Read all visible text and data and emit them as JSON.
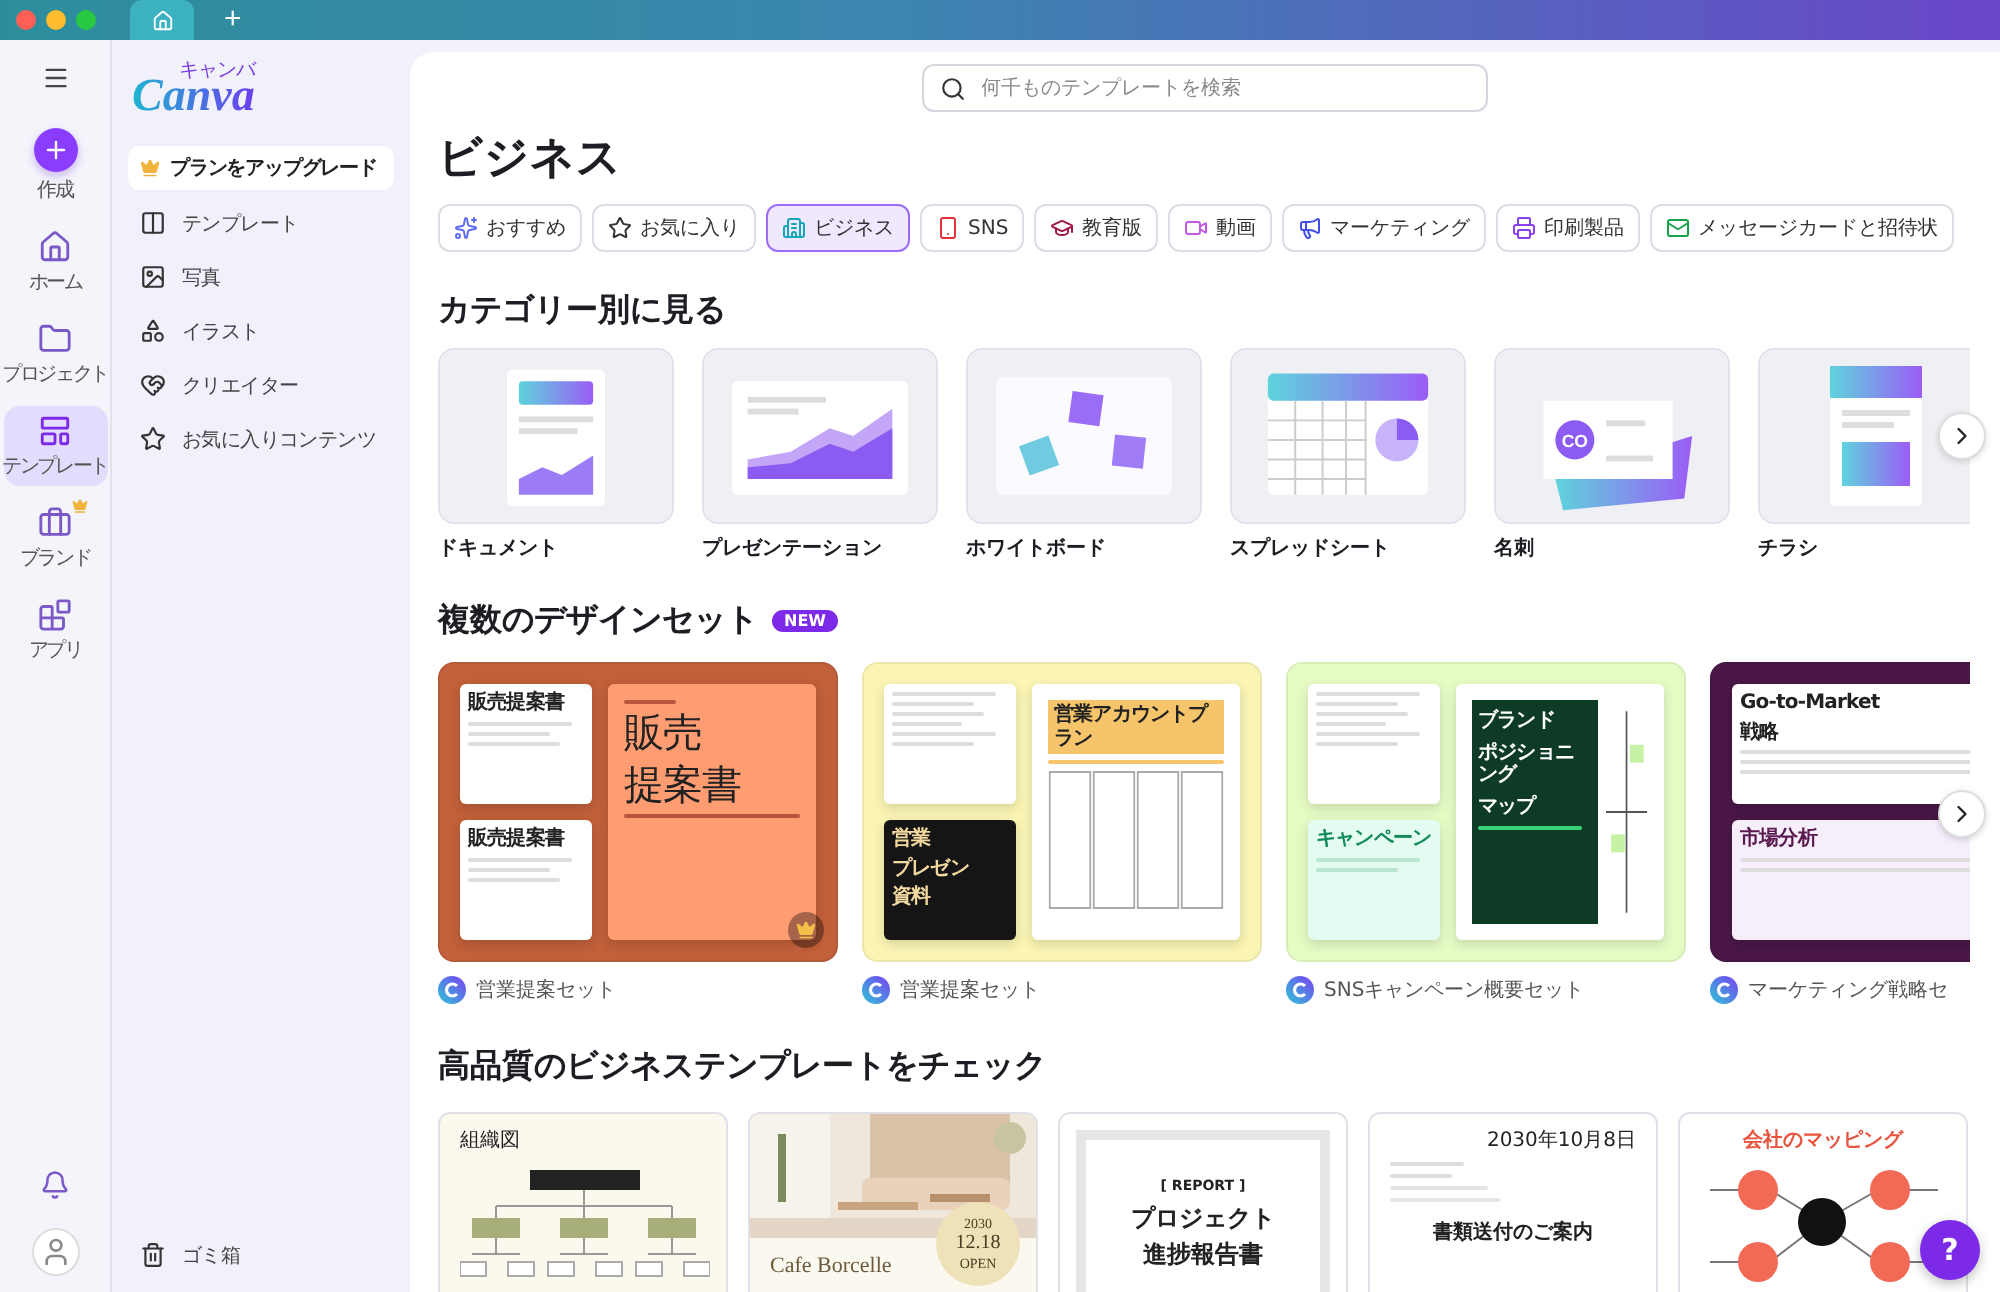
{
  "title_bar": {
    "tabs": [
      {
        "kind": "home",
        "selected": true
      }
    ],
    "new_tab": "+"
  },
  "rail": {
    "items": [
      {
        "label": "作成",
        "kind": "create",
        "selected": false,
        "premium": false
      },
      {
        "label": "ホーム",
        "kind": "home",
        "selected": false,
        "premium": false
      },
      {
        "label": "プロジェクト",
        "kind": "projects",
        "selected": false,
        "premium": false
      },
      {
        "label": "テンプレート",
        "kind": "templates",
        "selected": true,
        "premium": false
      },
      {
        "label": "ブランド",
        "kind": "brand",
        "selected": false,
        "premium": true
      },
      {
        "label": "アプリ",
        "kind": "apps",
        "selected": false,
        "premium": false
      }
    ]
  },
  "side_panel": {
    "logo": "Canva",
    "logo_kana": "キャンバ",
    "upgrade": "プランをアップグレード",
    "items": [
      {
        "label": "テンプレート",
        "kind": "templates"
      },
      {
        "label": "写真",
        "kind": "photos"
      },
      {
        "label": "イラスト",
        "kind": "illustrations"
      },
      {
        "label": "クリエイター",
        "kind": "creators"
      },
      {
        "label": "お気に入りコンテンツ",
        "kind": "favorites"
      }
    ],
    "trash": "ゴミ箱"
  },
  "search": {
    "placeholder": "何千ものテンプレートを検索"
  },
  "heading": "ビジネス",
  "filters": [
    {
      "label": "おすすめ",
      "kind": "recommended",
      "selected": false
    },
    {
      "label": "お気に入り",
      "kind": "favorites",
      "selected": false
    },
    {
      "label": "ビジネス",
      "kind": "business",
      "selected": true
    },
    {
      "label": "SNS",
      "kind": "sns",
      "selected": false
    },
    {
      "label": "教育版",
      "kind": "education",
      "selected": false
    },
    {
      "label": "動画",
      "kind": "video",
      "selected": false
    },
    {
      "label": "マーケティング",
      "kind": "marketing",
      "selected": false
    },
    {
      "label": "印刷製品",
      "kind": "print",
      "selected": false
    },
    {
      "label": "メッセージカードと招待状",
      "kind": "cards",
      "selected": false
    }
  ],
  "categories": {
    "title": "カテゴリー別に見る",
    "items": [
      {
        "label": "ドキュメント",
        "kind": "document"
      },
      {
        "label": "プレゼンテーション",
        "kind": "presentation"
      },
      {
        "label": "ホワイトボード",
        "kind": "whiteboard"
      },
      {
        "label": "スプレッドシート",
        "kind": "spreadsheet"
      },
      {
        "label": "名刺",
        "kind": "business_card",
        "mark": "CO"
      },
      {
        "label": "チラシ",
        "kind": "flyer"
      }
    ]
  },
  "design_sets": {
    "title": "複数のデザインセット",
    "badge": "NEW",
    "items": [
      {
        "name": "営業提案セット",
        "color": "#c1603a",
        "premium": true,
        "pages": [
          {
            "kind": "doc",
            "lines": [
              "販売提案書"
            ]
          },
          {
            "kind": "doc",
            "lines": [
              "販売提案書"
            ]
          },
          {
            "kind": "cover",
            "lines": [
              "販売",
              "提案書"
            ]
          }
        ]
      },
      {
        "name": "営業提案セット",
        "color": "#faf5b4",
        "premium": false,
        "pages": [
          {
            "kind": "doc"
          },
          {
            "kind": "dark",
            "lines": [
              "営業",
              "プレゼン",
              "資料"
            ]
          },
          {
            "kind": "table",
            "lines": [
              "営業アカウントプラン"
            ]
          }
        ]
      },
      {
        "name": "SNSキャンペーン概要セット",
        "color": "#e6fbc4",
        "premium": false,
        "pages": [
          {
            "kind": "doc"
          },
          {
            "kind": "mint",
            "lines": [
              "キャンペーン"
            ]
          },
          {
            "kind": "map",
            "lines": [
              "ブランド",
              "ポジショニング",
              "マップ"
            ]
          }
        ]
      },
      {
        "name": "マーケティング戦略セ",
        "color": "#4a1747",
        "premium": false,
        "pages": [
          {
            "kind": "doc",
            "lines": [
              "Go-to-Market",
              "戦略"
            ]
          },
          {
            "lines": [
              "市場分析"
            ]
          }
        ]
      }
    ]
  },
  "business_templates": {
    "title": "高品質のビジネステンプレートをチェック",
    "items": [
      {
        "kind": "org_chart",
        "title": "組織図"
      },
      {
        "kind": "cafe_flyer",
        "title": "Cafe Borcelle",
        "year": "2030",
        "date": "12.18",
        "status": "OPEN"
      },
      {
        "kind": "report",
        "label": "[ REPORT ]",
        "title_lines": [
          "プロジェクト",
          "進捗報告書"
        ]
      },
      {
        "kind": "letter",
        "date": "2030年10月8日",
        "title": "書類送付のご案内"
      },
      {
        "kind": "mind_map",
        "title": "会社のマッピング"
      }
    ]
  },
  "help": "?"
}
